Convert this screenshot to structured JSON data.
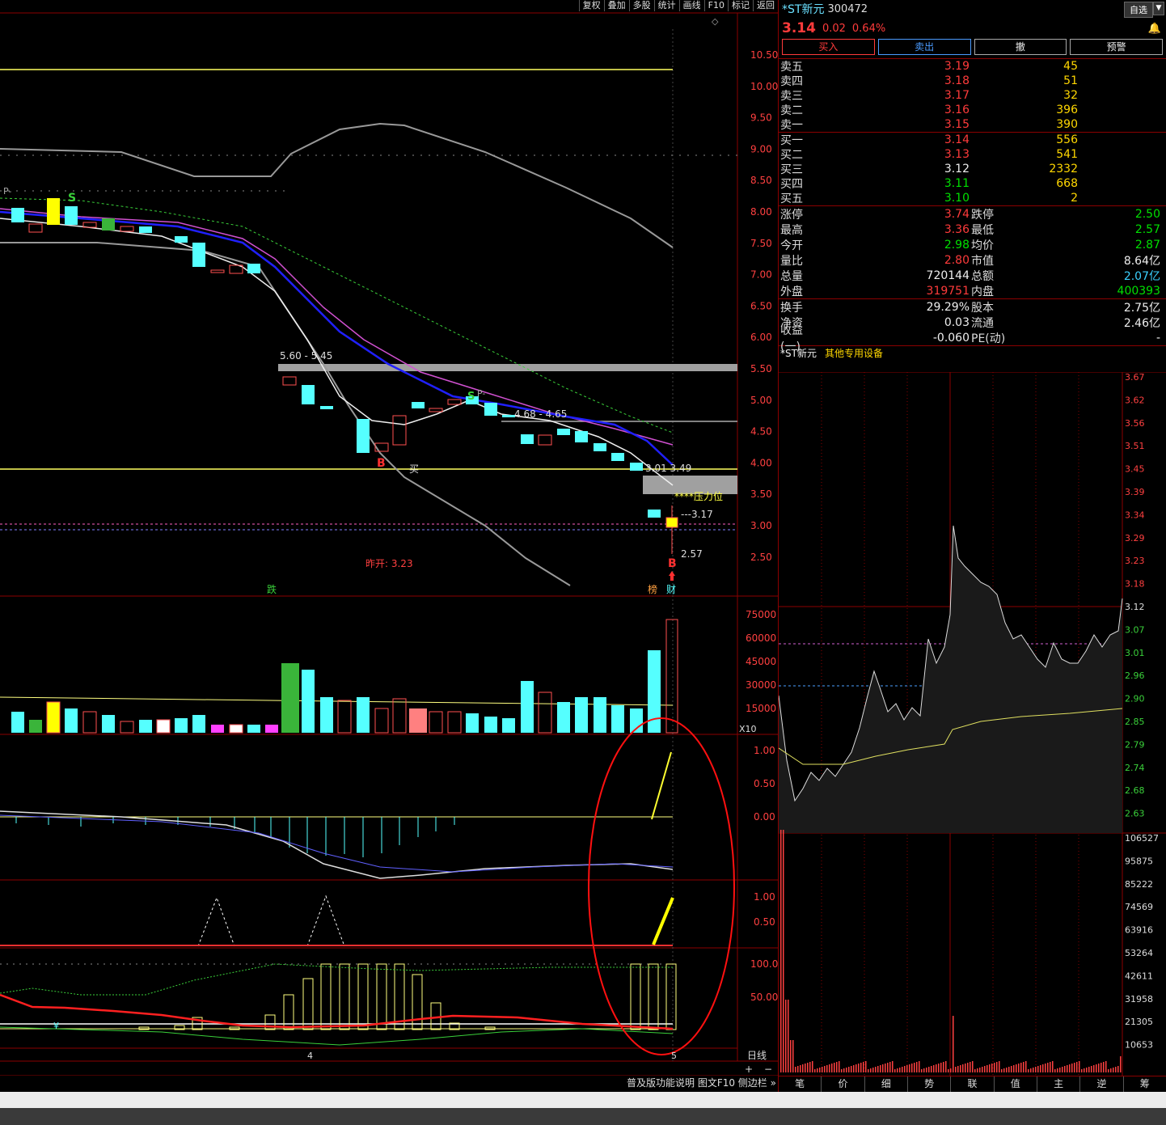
{
  "toolbar": [
    "复权",
    "叠加",
    "多股",
    "统计",
    "画线",
    "F10",
    "标记",
    "返回"
  ],
  "stock": {
    "name": "*ST新元",
    "code": "300472",
    "price": "3.14",
    "change": "0.02",
    "change_pct": "0.64%"
  },
  "self_select": "自选",
  "self_select_arrow": "▼",
  "actions": [
    "买入",
    "卖出",
    "撤",
    "预警"
  ],
  "asks": [
    {
      "label": "卖五",
      "price": "3.19",
      "vol": "45"
    },
    {
      "label": "卖四",
      "price": "3.18",
      "vol": "51"
    },
    {
      "label": "卖三",
      "price": "3.17",
      "vol": "32"
    },
    {
      "label": "卖二",
      "price": "3.16",
      "vol": "396"
    },
    {
      "label": "卖一",
      "price": "3.15",
      "vol": "390"
    }
  ],
  "bids": [
    {
      "label": "买一",
      "price": "3.14",
      "vol": "556",
      "color": "red"
    },
    {
      "label": "买二",
      "price": "3.13",
      "vol": "541",
      "color": "red"
    },
    {
      "label": "买三",
      "price": "3.12",
      "vol": "2332",
      "color": "white"
    },
    {
      "label": "买四",
      "price": "3.11",
      "vol": "668",
      "color": "green"
    },
    {
      "label": "买五",
      "price": "3.10",
      "vol": "2",
      "color": "green"
    }
  ],
  "stats1": [
    {
      "l": "涨停",
      "v": "3.74",
      "vc": "red",
      "l2": "跌停",
      "v2": "2.50",
      "v2c": "green"
    },
    {
      "l": "最高",
      "v": "3.36",
      "vc": "red",
      "l2": "最低",
      "v2": "2.57",
      "v2c": "green"
    },
    {
      "l": "今开",
      "v": "2.98",
      "vc": "green",
      "l2": "均价",
      "v2": "2.87",
      "v2c": "green"
    },
    {
      "l": "量比",
      "v": "2.80",
      "vc": "red",
      "l2": "市值",
      "v2": "8.64亿",
      "v2c": "white"
    },
    {
      "l": "总量",
      "v": "720144",
      "vc": "white",
      "l2": "总额",
      "v2": "2.07亿",
      "v2c": "cyan"
    },
    {
      "l": "外盘",
      "v": "319751",
      "vc": "red",
      "l2": "内盘",
      "v2": "400393",
      "v2c": "green"
    }
  ],
  "stats2": [
    {
      "l": "换手",
      "v": "29.29%",
      "vc": "white",
      "l2": "股本",
      "v2": "2.75亿",
      "v2c": "white"
    },
    {
      "l": "净资",
      "v": "0.03",
      "vc": "white",
      "l2": "流通",
      "v2": "2.46亿",
      "v2c": "white"
    },
    {
      "l": "收益(一)",
      "v": "-0.060",
      "vc": "white",
      "l2": "PE(动)",
      "v2": "-",
      "v2c": "white"
    }
  ],
  "mini_chart": {
    "name": "*ST新元",
    "industry": "其他专用设备",
    "price_ticks": [
      "3.67",
      "3.62",
      "3.56",
      "3.51",
      "3.45",
      "3.39",
      "3.34",
      "3.29",
      "3.23",
      "3.18",
      "3.12",
      "3.07",
      "3.01",
      "2.96",
      "2.90",
      "2.85",
      "2.79",
      "2.74",
      "2.68",
      "2.63"
    ],
    "vol_ticks": [
      "106527",
      "95875",
      "85222",
      "74569",
      "63916",
      "53264",
      "42611",
      "31958",
      "21305",
      "10653"
    ]
  },
  "bottom_tabs": [
    "笔",
    "价",
    "细",
    "势",
    "联",
    "值",
    "主",
    "逆",
    "筹"
  ],
  "statusbar": "普及版功能说明 图文F10 侧边栏 »",
  "chart": {
    "price_ticks": [
      "10.50",
      "10.00",
      "9.50",
      "9.00",
      "8.50",
      "8.00",
      "7.50",
      "7.00",
      "6.50",
      "6.00",
      "5.50",
      "5.00",
      "4.50",
      "4.00",
      "3.50",
      "3.00",
      "2.50"
    ],
    "vol_ticks": [
      "75000",
      "60000",
      "45000",
      "30000",
      "15000"
    ],
    "vol_unit": "X10",
    "macd_ticks": [
      "1.00",
      "0.50",
      "0.00"
    ],
    "ind2_ticks": [
      "1.00",
      "0.50"
    ],
    "ind3_ticks": [
      "100.0",
      "50.00"
    ],
    "labels": {
      "zone1": "5.60 - 5.45",
      "zone2": "4.68 - 4.65",
      "p349": "3.01  3.49",
      "pressure": "****压力位",
      "p317": "---3.17",
      "p257": "2.57",
      "prev_open": "昨开: 3.23",
      "buy": "买",
      "b1": "B",
      "b2": "B",
      "s1": "S",
      "s2": "S",
      "p1": "P-",
      "p2": "P-",
      "die": "跌",
      "bang": "榜",
      "cai": "财",
      "x4": "4",
      "x5": "5",
      "daily": "日线",
      "plus": "+",
      "minus": "−",
      "diamond": "◇",
      "v_mark": "¥"
    }
  }
}
